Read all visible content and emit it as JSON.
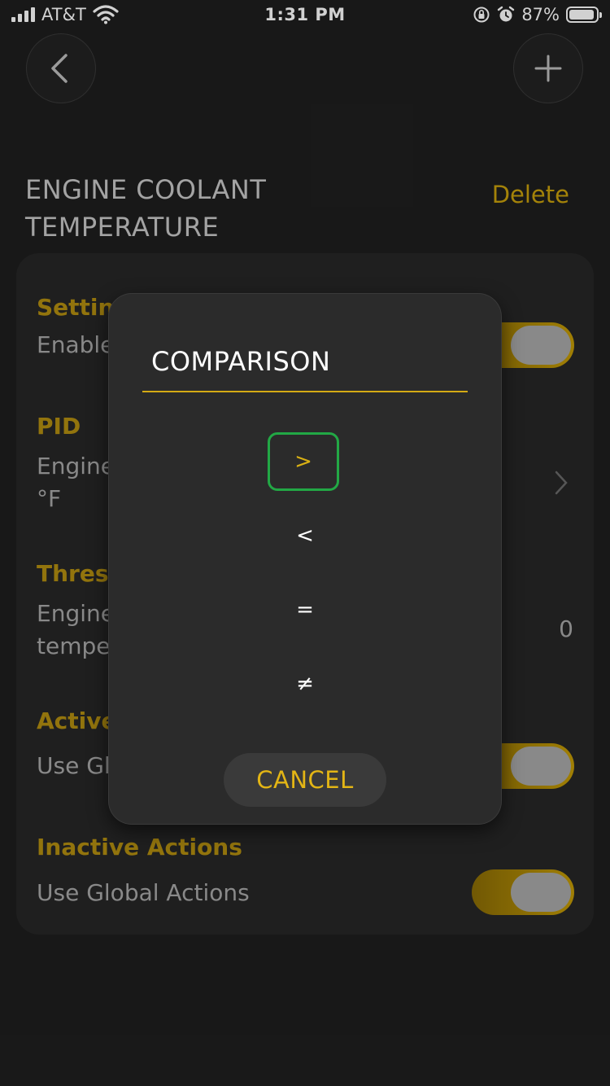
{
  "status_bar": {
    "carrier": "AT&T",
    "time": "1:31 PM",
    "battery": "87%",
    "battery_level": 0.87
  },
  "nav": {
    "back_icon": "chevron-left-icon",
    "add_icon": "plus-icon"
  },
  "header": {
    "title": "ENGINE COOLANT TEMPERATURE",
    "delete_label": "Delete"
  },
  "card": {
    "settings": {
      "heading": "Setting",
      "row_label": "Enable",
      "toggle_on": true
    },
    "pid": {
      "heading": "PID",
      "line1": "Engine",
      "line2": "°F"
    },
    "threshold": {
      "heading": "Thresh",
      "line1": "Engine",
      "line2": "tempe",
      "value": "0"
    },
    "active_actions": {
      "heading": "Active",
      "row_label": "Use Gl",
      "toggle_on": true
    },
    "inactive_actions": {
      "heading": "Inactive Actions",
      "row_label": "Use Global Actions",
      "toggle_on": true
    }
  },
  "dialog": {
    "title": "COMPARISON",
    "options": [
      ">",
      "<",
      "=",
      "≠"
    ],
    "selected_index": 0,
    "cancel_label": "CANCEL"
  },
  "colors": {
    "accent": "#c9a00c",
    "selection_border": "#22a845",
    "background": "#1e1e1e",
    "card": "#272727"
  }
}
